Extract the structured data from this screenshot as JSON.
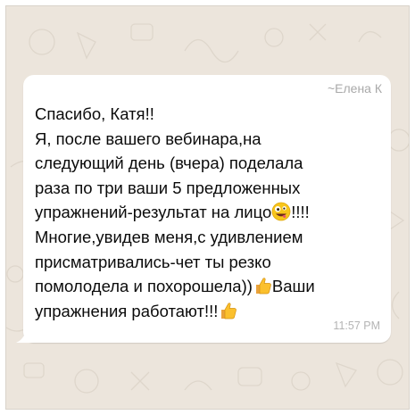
{
  "chat": {
    "sender": "~Елена К",
    "time": "11:57 PM",
    "bubble_color": "#ffffff",
    "wallpaper_color": "#ece5dc",
    "lines": [
      "Спасибо, Катя!!",
      "Я, после вашего вебинара,на",
      "следующий день (вчера) поделала",
      "раза по три ваши 5 предложенных",
      "упражнений-результат на лицо",
      "!!!!",
      "Многие,увидев меня,с удивлением",
      "присматривались-чет ты резко",
      "помолодела и похорошела))",
      "Ваши",
      "упражнения работают!!!"
    ],
    "icons": [
      "zany-face-emoji-icon",
      "thumbs-up-emoji-icon"
    ]
  }
}
